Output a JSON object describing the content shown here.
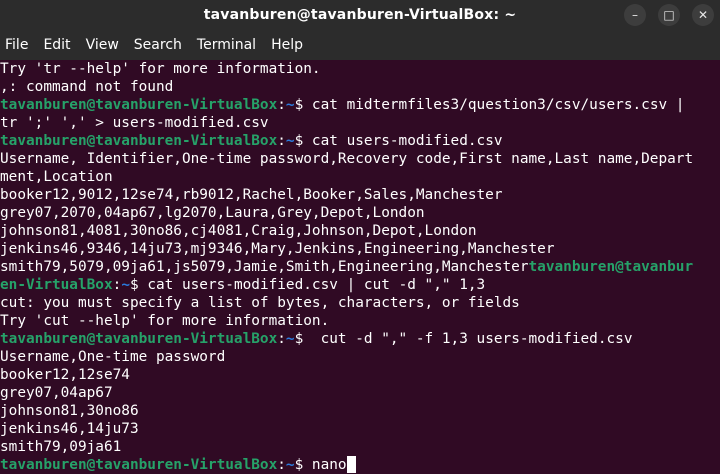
{
  "window": {
    "title": "tavanburen@tavanburen-VirtualBox: ~",
    "controls": {
      "search": "⌕",
      "menu": "☰",
      "minimize": "–",
      "maximize": "□",
      "close": "✕"
    }
  },
  "menu": [
    "File",
    "Edit",
    "View",
    "Search",
    "Terminal",
    "Help"
  ],
  "prompt": {
    "user_host": "tavanburen@tavanburen-VirtualBox",
    "colon": ":",
    "path": "~",
    "dollar": "$ "
  },
  "lines": [
    {
      "type": "out",
      "text": "Try 'tr --help' for more information."
    },
    {
      "type": "out",
      "text": ",: command not found"
    },
    {
      "type": "cmd",
      "text": "cat midtermfiles3/question3/csv/users.csv |"
    },
    {
      "type": "out",
      "text": "tr ';' ',' > users-modified.csv"
    },
    {
      "type": "cmd",
      "text": "cat users-modified.csv"
    },
    {
      "type": "out",
      "text": "Username, Identifier,One-time password,Recovery code,First name,Last name,Depart"
    },
    {
      "type": "out",
      "text": "ment,Location"
    },
    {
      "type": "out",
      "text": "booker12,9012,12se74,rb9012,Rachel,Booker,Sales,Manchester"
    },
    {
      "type": "out",
      "text": "grey07,2070,04ap67,lg2070,Laura,Grey,Depot,London"
    },
    {
      "type": "out",
      "text": "johnson81,4081,30no86,cj4081,Craig,Johnson,Depot,London"
    },
    {
      "type": "out",
      "text": "jenkins46,9346,14ju73,mj9346,Mary,Jenkins,Engineering,Manchester"
    },
    {
      "type": "wrap",
      "text": "smith79,5079,09ja61,js5079,Jamie,Smith,Engineering,Manchester",
      "tail": "tavanburen@tavanbur"
    },
    {
      "type": "cont",
      "head": "en-VirtualBox",
      "text": "cat users-modified.csv | cut -d \",\" 1,3"
    },
    {
      "type": "out",
      "text": "cut: you must specify a list of bytes, characters, or fields"
    },
    {
      "type": "out",
      "text": "Try 'cut --help' for more information."
    },
    {
      "type": "cmd",
      "text": " cut -d \",\" -f 1,3 users-modified.csv"
    },
    {
      "type": "out",
      "text": "Username,One-time password"
    },
    {
      "type": "out",
      "text": "booker12,12se74"
    },
    {
      "type": "out",
      "text": "grey07,04ap67"
    },
    {
      "type": "out",
      "text": "johnson81,30no86"
    },
    {
      "type": "out",
      "text": "jenkins46,14ju73"
    },
    {
      "type": "out",
      "text": "smith79,09ja61"
    },
    {
      "type": "cmd",
      "text": "nano",
      "cursor": true
    }
  ],
  "colors": {
    "background": "#300a24",
    "chrome": "#2c2c2c",
    "prompt_user": "#26a269",
    "prompt_path": "#12488b",
    "text": "#ffffff"
  }
}
